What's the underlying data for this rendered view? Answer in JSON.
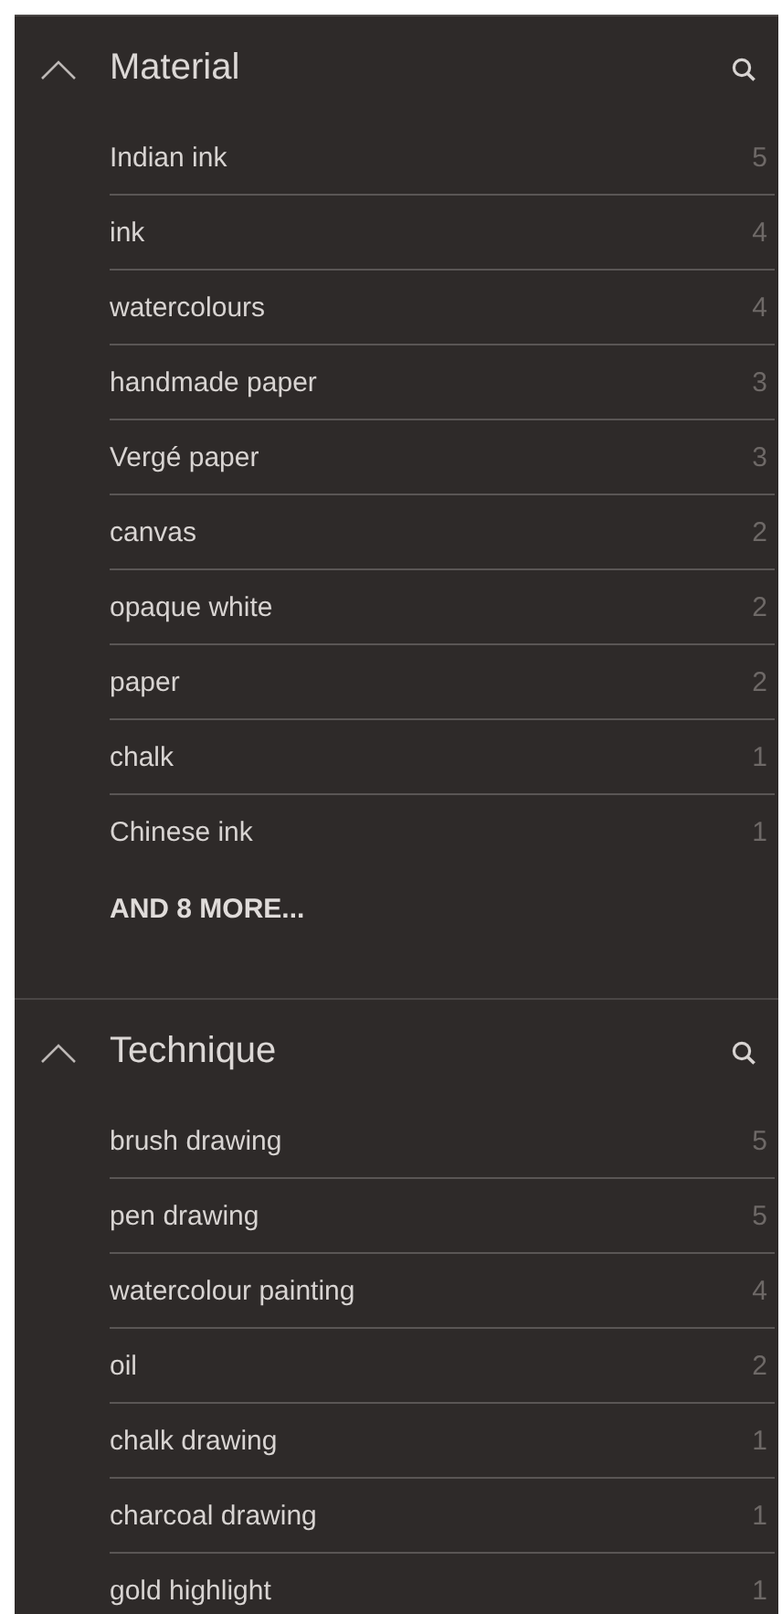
{
  "sections": [
    {
      "title": "Material",
      "expanded": true,
      "items": [
        {
          "label": "Indian ink",
          "count": "5"
        },
        {
          "label": "ink",
          "count": "4"
        },
        {
          "label": "watercolours",
          "count": "4"
        },
        {
          "label": "handmade paper",
          "count": "3"
        },
        {
          "label": "Vergé paper",
          "count": "3"
        },
        {
          "label": "canvas",
          "count": "2"
        },
        {
          "label": "opaque white",
          "count": "2"
        },
        {
          "label": "paper",
          "count": "2"
        },
        {
          "label": "chalk",
          "count": "1"
        },
        {
          "label": "Chinese ink",
          "count": "1"
        }
      ],
      "more": "AND 8 MORE..."
    },
    {
      "title": "Technique",
      "expanded": true,
      "items": [
        {
          "label": "brush drawing",
          "count": "5"
        },
        {
          "label": "pen drawing",
          "count": "5"
        },
        {
          "label": "watercolour painting",
          "count": "4"
        },
        {
          "label": "oil",
          "count": "2"
        },
        {
          "label": "chalk drawing",
          "count": "1"
        },
        {
          "label": "charcoal drawing",
          "count": "1"
        },
        {
          "label": "gold highlight",
          "count": "1"
        }
      ]
    }
  ]
}
